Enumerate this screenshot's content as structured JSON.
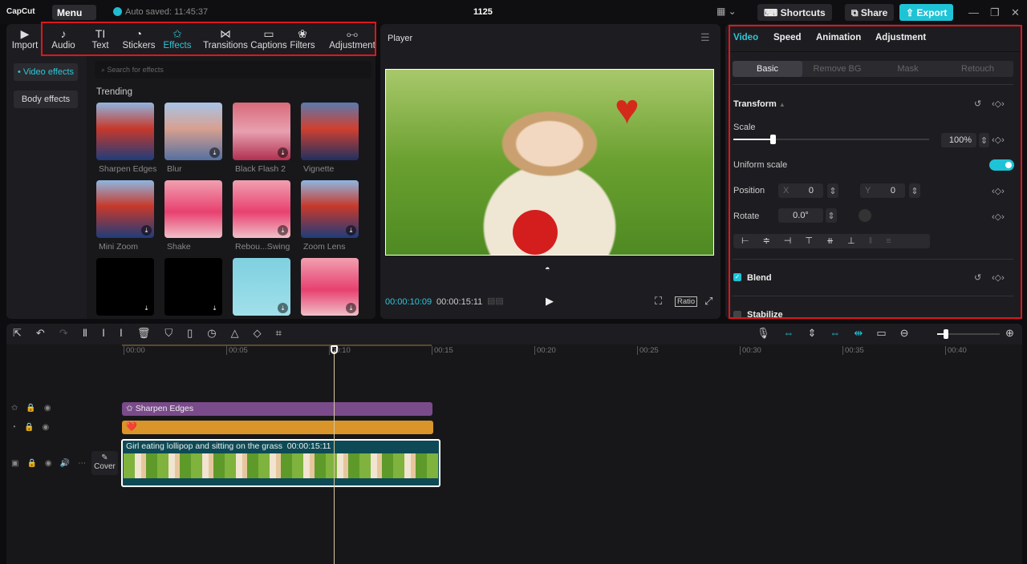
{
  "app": {
    "logo": "CapCut",
    "menu": "Menu",
    "auto_saved": "Auto saved: 11:45:37",
    "project_name": "1125",
    "shortcuts": "Shortcuts",
    "share": "Share",
    "export": "Export"
  },
  "toolbar": [
    {
      "label": "Import",
      "icon": "import-icon",
      "glyph": "▶"
    },
    {
      "label": "Audio",
      "icon": "audio-icon",
      "glyph": "♪"
    },
    {
      "label": "Text",
      "icon": "text-icon",
      "glyph": "TI"
    },
    {
      "label": "Stickers",
      "icon": "sticker-icon",
      "glyph": "◔"
    },
    {
      "label": "Effects",
      "icon": "effects-icon",
      "glyph": "✩"
    },
    {
      "label": "Transitions",
      "icon": "transitions-icon",
      "glyph": "⋈"
    },
    {
      "label": "Captions",
      "icon": "captions-icon",
      "glyph": "▭"
    },
    {
      "label": "Filters",
      "icon": "filters-icon",
      "glyph": "❀"
    },
    {
      "label": "Adjustment",
      "icon": "adjustment-icon",
      "glyph": "⧟"
    }
  ],
  "effects_sidebar": {
    "video_effects": "• Video effects",
    "body_effects": "Body effects"
  },
  "effects": {
    "search_placeholder": "Search for effects",
    "section": "Trending",
    "items": [
      {
        "label": "Sharpen Edges"
      },
      {
        "label": "Blur"
      },
      {
        "label": "Black Flash 2"
      },
      {
        "label": "Vignette"
      },
      {
        "label": "Mini Zoom"
      },
      {
        "label": "Shake"
      },
      {
        "label": "Rebou...Swing"
      },
      {
        "label": "Zoom Lens"
      },
      {
        "label": ""
      },
      {
        "label": ""
      },
      {
        "label": ""
      },
      {
        "label": ""
      }
    ]
  },
  "player": {
    "title": "Player",
    "current_time": "00:00:10:09",
    "total_time": "00:00:15:11",
    "ratio": "Ratio"
  },
  "inspector": {
    "tabs": [
      "Video",
      "Speed",
      "Animation",
      "Adjustment"
    ],
    "subtabs": [
      "Basic",
      "Remove BG",
      "Mask",
      "Retouch"
    ],
    "transform": "Transform",
    "scale_label": "Scale",
    "scale_value": "100%",
    "scale_fraction": 0.2,
    "uniform_scale": "Uniform scale",
    "uniform_on": true,
    "position_label": "Position",
    "x_label": "X",
    "x_value": "0",
    "y_label": "Y",
    "y_value": "0",
    "rotate_label": "Rotate",
    "rotate_value": "0.0°",
    "blend": "Blend",
    "stabilize": "Stabilize"
  },
  "timeline": {
    "ruler": [
      "00:00",
      "00:05",
      "00:10",
      "00:15",
      "00:20",
      "00:25",
      "00:30",
      "00:35",
      "00:40"
    ],
    "effect_clip": "Sharpen Edges",
    "sticker_clip": "❤️",
    "video_clip_title": "Girl eating lollipop and sitting on the grass",
    "video_clip_duration": "00:00:15:11",
    "cover": "Cover"
  },
  "colors": {
    "accent": "#1fc3d6",
    "effect_clip": "#7a4b8a",
    "sticker_clip": "#d9942a",
    "video_clip": "#0d4a55",
    "highlight": "#e0151b"
  }
}
